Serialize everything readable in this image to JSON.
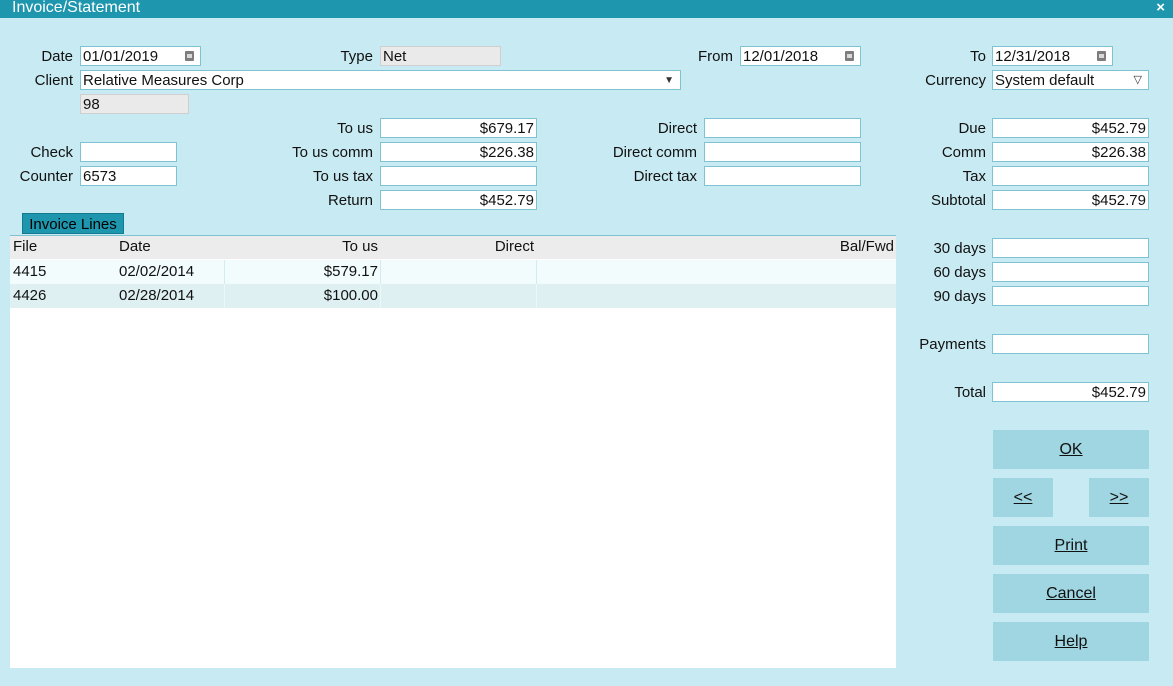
{
  "window": {
    "title": "Invoice/Statement",
    "close_glyph": "×"
  },
  "header": {
    "date_label": "Date",
    "date_value": "01/01/2019",
    "type_label": "Type",
    "type_value": "Net",
    "from_label": "From",
    "from_value": "12/01/2018",
    "to_label": "To",
    "to_value": "12/31/2018",
    "client_label": "Client",
    "client_value": "Relative Measures Corp",
    "client_code": "98",
    "currency_label": "Currency",
    "currency_value": "System default"
  },
  "fields": {
    "to_us_label": "To us",
    "to_us_value": "$679.17",
    "to_us_comm_label": "To us comm",
    "to_us_comm_value": "$226.38",
    "to_us_tax_label": "To us tax",
    "to_us_tax_value": "",
    "return_label": "Return",
    "return_value": "$452.79",
    "check_label": "Check",
    "check_value": "",
    "counter_label": "Counter",
    "counter_value": "6573",
    "direct_label": "Direct",
    "direct_value": "",
    "direct_comm_label": "Direct comm",
    "direct_comm_value": "",
    "direct_tax_label": "Direct tax",
    "direct_tax_value": ""
  },
  "summary": {
    "due_label": "Due",
    "due_value": "$452.79",
    "comm_label": "Comm",
    "comm_value": "$226.38",
    "tax_label": "Tax",
    "tax_value": "",
    "subtotal_label": "Subtotal",
    "subtotal_value": "$452.79",
    "d30_label": "30 days",
    "d30_value": "",
    "d60_label": "60 days",
    "d60_value": "",
    "d90_label": "90 days",
    "d90_value": "",
    "payments_label": "Payments",
    "payments_value": "",
    "total_label": "Total",
    "total_value": "$452.79"
  },
  "invoice_lines": {
    "tab_label": "Invoice Lines",
    "columns": [
      "File",
      "Date",
      "To us",
      "Direct",
      "Bal/Fwd"
    ],
    "rows": [
      {
        "file": "4415",
        "date": "02/02/2014",
        "to_us": "$579.17",
        "direct": "",
        "bal_fwd": ""
      },
      {
        "file": "4426",
        "date": "02/28/2014",
        "to_us": "$100.00",
        "direct": "",
        "bal_fwd": ""
      }
    ]
  },
  "buttons": {
    "ok": "OK",
    "prev": "<<",
    "next": ">>",
    "print": "Print",
    "cancel": "Cancel",
    "help": "Help"
  },
  "colors": {
    "background": "#c8eaf2",
    "titlebar": "#1e96ad",
    "button": "#9fd6e1",
    "row_even": "#f2fcfd",
    "row_odd": "#dff0f3"
  }
}
